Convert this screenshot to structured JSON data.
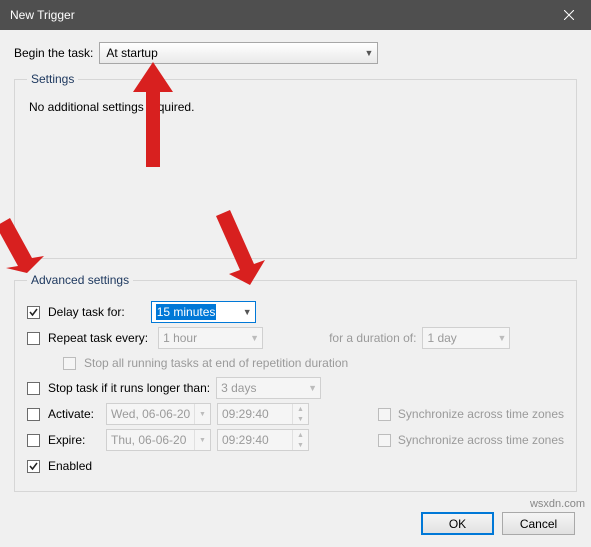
{
  "title_bar": {
    "title": "New Trigger"
  },
  "begin_task": {
    "label": "Begin the task:",
    "value": "At startup"
  },
  "settings": {
    "legend": "Settings",
    "message": "No additional settings required."
  },
  "advanced": {
    "legend": "Advanced settings",
    "delay_task": {
      "checked": true,
      "label": "Delay task for:",
      "value": "15 minutes"
    },
    "repeat_task": {
      "checked": false,
      "label": "Repeat task every:",
      "value": "1 hour",
      "duration_label": "for a duration of:",
      "duration_value": "1 day"
    },
    "stop_all": {
      "checked": false,
      "label": "Stop all running tasks at end of repetition duration"
    },
    "stop_if": {
      "checked": false,
      "label": "Stop task if it runs longer than:",
      "value": "3 days"
    },
    "activate": {
      "checked": false,
      "label": "Activate:",
      "date": "Wed, 06-06-20",
      "time": "09:29:40",
      "sync_label": "Synchronize across time zones"
    },
    "expire": {
      "checked": false,
      "label": "Expire:",
      "date": "Thu, 06-06-20",
      "time": "09:29:40",
      "sync_label": "Synchronize across time zones"
    },
    "enabled": {
      "checked": true,
      "label": "Enabled"
    }
  },
  "buttons": {
    "ok": "OK",
    "cancel": "Cancel"
  },
  "watermark": "wsxdn.com"
}
